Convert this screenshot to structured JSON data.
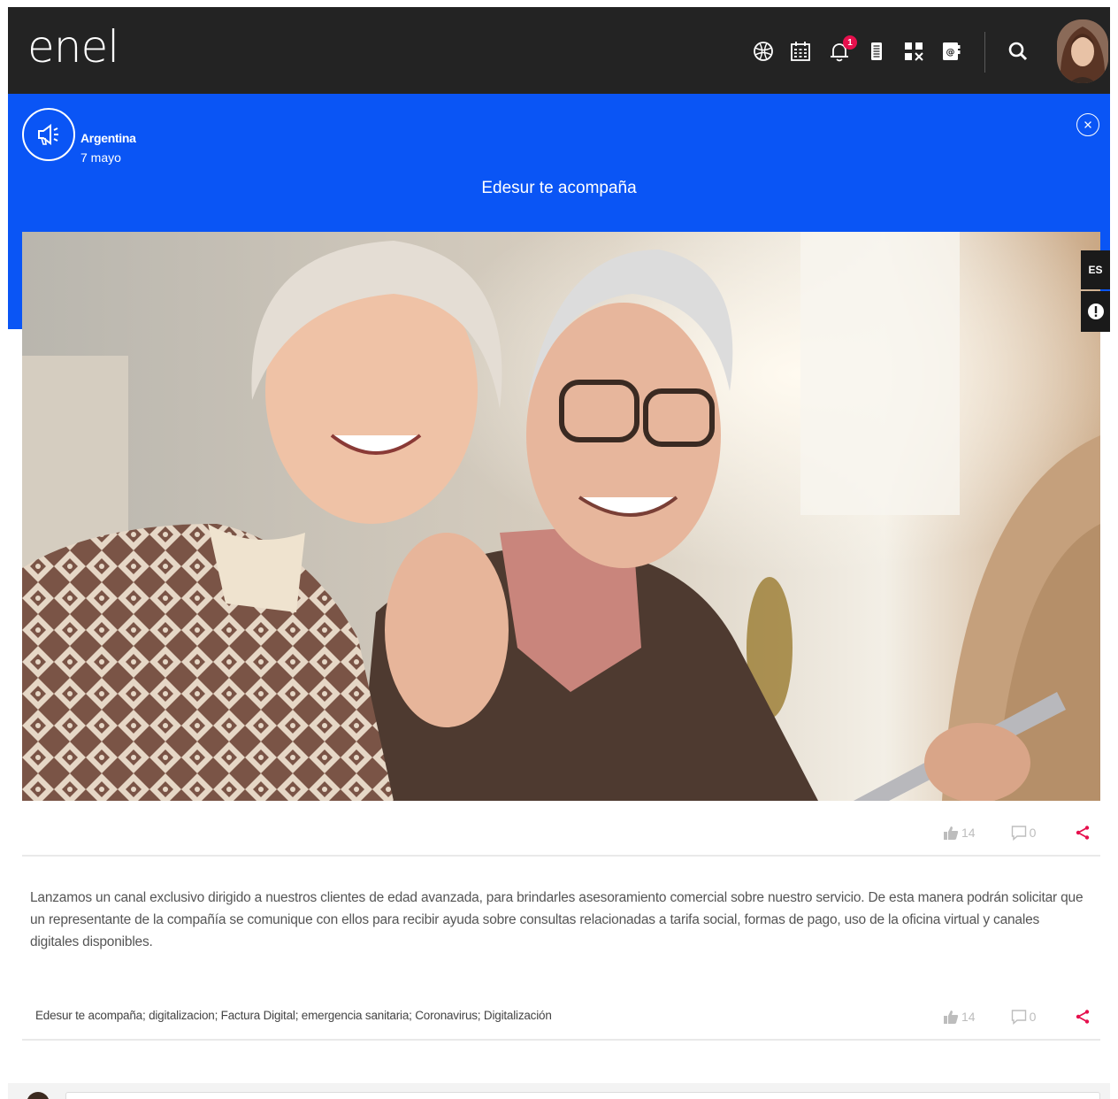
{
  "header": {
    "logo": "enel",
    "notification_count": "1",
    "icons": [
      "globe-icon",
      "calendar-icon",
      "bell-icon",
      "document-icon",
      "apps-icon",
      "email-contact-icon",
      "search-icon"
    ]
  },
  "post": {
    "country": "Argentina",
    "date": "7 mayo",
    "title": "Edesur te acompaña",
    "likes": "14",
    "comments": "0",
    "body": "Lanzamos un canal exclusivo dirigido a nuestros clientes de edad avanzada, para brindarles asesoramiento comercial sobre nuestro servicio. De esta manera podrán solicitar que un representante de la compañía se comunique con ellos para recibir ayuda sobre consultas relacionadas a tarifa social, formas de pago, uso de la oficina virtual y canales digitales disponibles.",
    "tags": "Edesur te acompaña; digitalizacion; Factura Digital; emergencia sanitaria; Coronavirus; Digitalización"
  },
  "side": {
    "language": "ES"
  },
  "colors": {
    "header_bg": "#232323",
    "band_blue": "#0a55f5",
    "share_pink": "#e6104d",
    "muted_gray": "#bdbdbd"
  }
}
